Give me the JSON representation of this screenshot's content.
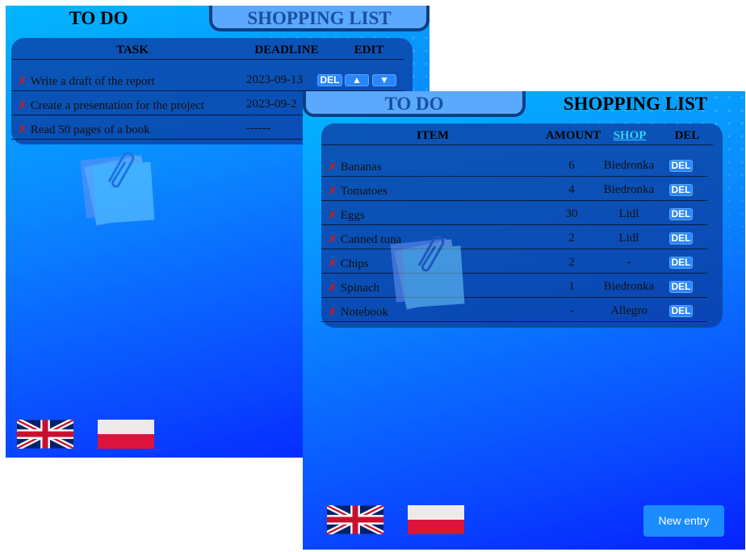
{
  "todo_window": {
    "tabs": {
      "todo": "TO DO",
      "shopping": "SHOPPING LIST"
    },
    "headers": {
      "task": "TASK",
      "deadline": "DEADLINE",
      "edit": "EDIT"
    },
    "rows": [
      {
        "task": "Write a draft of the report",
        "deadline": "2023-09-13"
      },
      {
        "task": "Create a presentation for the project",
        "deadline": "2023-09-2"
      },
      {
        "task": "Read 50 pages of a book",
        "deadline": "------"
      }
    ],
    "del_label": "DEL",
    "up_label": "▲",
    "down_label": "▼"
  },
  "shopping_window": {
    "tabs": {
      "todo": "TO DO",
      "shopping": "SHOPPING LIST"
    },
    "headers": {
      "item": "ITEM",
      "amount": "AMOUNT",
      "shop": "SHOP",
      "del": "DEL"
    },
    "rows": [
      {
        "item": "Bananas",
        "amount": "6",
        "shop": "Biedronka"
      },
      {
        "item": "Tomatoes",
        "amount": "4",
        "shop": "Biedronka"
      },
      {
        "item": "Eggs",
        "amount": "30",
        "shop": "Lidl"
      },
      {
        "item": "Canned tuna",
        "amount": "2",
        "shop": "Lidl"
      },
      {
        "item": "Chips",
        "amount": "2",
        "shop": "-"
      },
      {
        "item": "Spinach",
        "amount": "1",
        "shop": "Biedronka"
      },
      {
        "item": "Notebook",
        "amount": "-",
        "shop": "Allegro"
      }
    ],
    "del_label": "DEL",
    "new_entry_label": "New entry"
  },
  "remove_mark": "✗",
  "icons": {
    "english_flag": "uk-flag-icon",
    "polish_flag": "poland-flag-icon",
    "decoration": "sticky-notes-icon"
  },
  "colors": {
    "background_top": "#02b6ff",
    "background_bottom": "#0522ff",
    "button": "#2a86ff",
    "remove_mark": "#e01414",
    "shop_link": "#34d3ff",
    "inactive_tab": "#5aa9ff"
  }
}
